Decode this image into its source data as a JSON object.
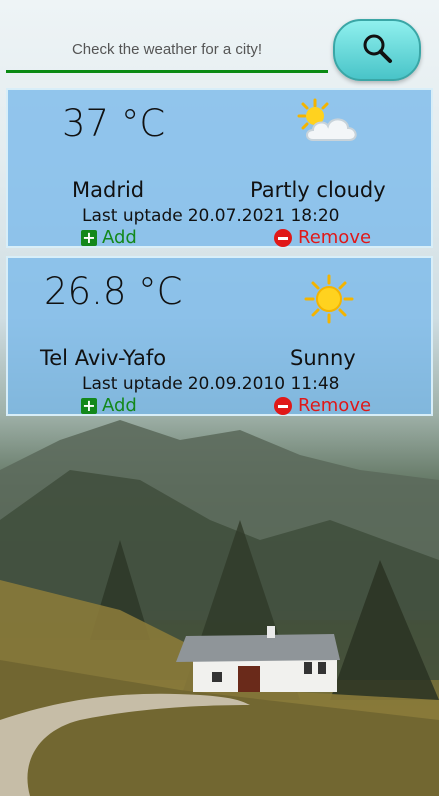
{
  "search": {
    "placeholder": "Check the weather for a city!",
    "button_icon": "search-icon"
  },
  "cards": [
    {
      "temperature": "37 °C",
      "city": "Madrid",
      "condition": "Partly cloudy",
      "updated_label": "Last uptade",
      "updated_value": "20.07.2021 18:20",
      "add_label": "Add",
      "remove_label": "Remove",
      "icon": "partly-cloudy-icon"
    },
    {
      "temperature": "26.8 °C",
      "city": "Tel Aviv-Yafo",
      "condition": "Sunny",
      "updated_label": "Last uptade",
      "updated_value": "20.09.2010 11:48",
      "add_label": "Add",
      "remove_label": "Remove",
      "icon": "sun-icon"
    }
  ],
  "colors": {
    "card_background": "#78b9eb",
    "add": "#13881b",
    "remove": "#e01818",
    "search_underline": "#0a8a13",
    "search_button": "#49c4c8"
  }
}
